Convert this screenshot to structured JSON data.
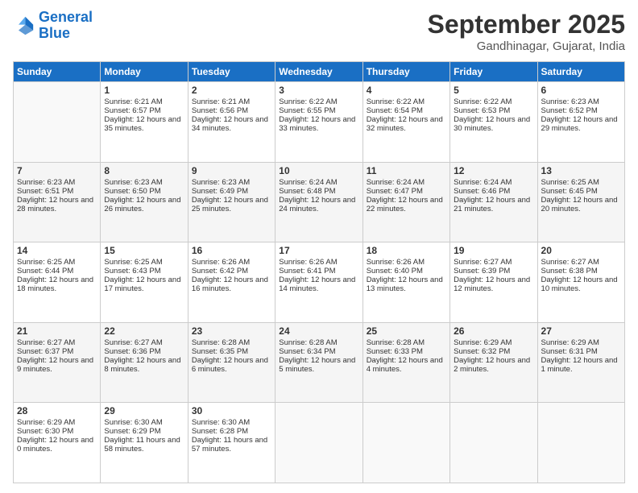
{
  "logo": {
    "line1": "General",
    "line2": "Blue"
  },
  "title": "September 2025",
  "location": "Gandhinagar, Gujarat, India",
  "days_header": [
    "Sunday",
    "Monday",
    "Tuesday",
    "Wednesday",
    "Thursday",
    "Friday",
    "Saturday"
  ],
  "weeks": [
    [
      {
        "day": "",
        "sunrise": "",
        "sunset": "",
        "daylight": ""
      },
      {
        "day": "1",
        "sunrise": "Sunrise: 6:21 AM",
        "sunset": "Sunset: 6:57 PM",
        "daylight": "Daylight: 12 hours and 35 minutes."
      },
      {
        "day": "2",
        "sunrise": "Sunrise: 6:21 AM",
        "sunset": "Sunset: 6:56 PM",
        "daylight": "Daylight: 12 hours and 34 minutes."
      },
      {
        "day": "3",
        "sunrise": "Sunrise: 6:22 AM",
        "sunset": "Sunset: 6:55 PM",
        "daylight": "Daylight: 12 hours and 33 minutes."
      },
      {
        "day": "4",
        "sunrise": "Sunrise: 6:22 AM",
        "sunset": "Sunset: 6:54 PM",
        "daylight": "Daylight: 12 hours and 32 minutes."
      },
      {
        "day": "5",
        "sunrise": "Sunrise: 6:22 AM",
        "sunset": "Sunset: 6:53 PM",
        "daylight": "Daylight: 12 hours and 30 minutes."
      },
      {
        "day": "6",
        "sunrise": "Sunrise: 6:23 AM",
        "sunset": "Sunset: 6:52 PM",
        "daylight": "Daylight: 12 hours and 29 minutes."
      }
    ],
    [
      {
        "day": "7",
        "sunrise": "Sunrise: 6:23 AM",
        "sunset": "Sunset: 6:51 PM",
        "daylight": "Daylight: 12 hours and 28 minutes."
      },
      {
        "day": "8",
        "sunrise": "Sunrise: 6:23 AM",
        "sunset": "Sunset: 6:50 PM",
        "daylight": "Daylight: 12 hours and 26 minutes."
      },
      {
        "day": "9",
        "sunrise": "Sunrise: 6:23 AM",
        "sunset": "Sunset: 6:49 PM",
        "daylight": "Daylight: 12 hours and 25 minutes."
      },
      {
        "day": "10",
        "sunrise": "Sunrise: 6:24 AM",
        "sunset": "Sunset: 6:48 PM",
        "daylight": "Daylight: 12 hours and 24 minutes."
      },
      {
        "day": "11",
        "sunrise": "Sunrise: 6:24 AM",
        "sunset": "Sunset: 6:47 PM",
        "daylight": "Daylight: 12 hours and 22 minutes."
      },
      {
        "day": "12",
        "sunrise": "Sunrise: 6:24 AM",
        "sunset": "Sunset: 6:46 PM",
        "daylight": "Daylight: 12 hours and 21 minutes."
      },
      {
        "day": "13",
        "sunrise": "Sunrise: 6:25 AM",
        "sunset": "Sunset: 6:45 PM",
        "daylight": "Daylight: 12 hours and 20 minutes."
      }
    ],
    [
      {
        "day": "14",
        "sunrise": "Sunrise: 6:25 AM",
        "sunset": "Sunset: 6:44 PM",
        "daylight": "Daylight: 12 hours and 18 minutes."
      },
      {
        "day": "15",
        "sunrise": "Sunrise: 6:25 AM",
        "sunset": "Sunset: 6:43 PM",
        "daylight": "Daylight: 12 hours and 17 minutes."
      },
      {
        "day": "16",
        "sunrise": "Sunrise: 6:26 AM",
        "sunset": "Sunset: 6:42 PM",
        "daylight": "Daylight: 12 hours and 16 minutes."
      },
      {
        "day": "17",
        "sunrise": "Sunrise: 6:26 AM",
        "sunset": "Sunset: 6:41 PM",
        "daylight": "Daylight: 12 hours and 14 minutes."
      },
      {
        "day": "18",
        "sunrise": "Sunrise: 6:26 AM",
        "sunset": "Sunset: 6:40 PM",
        "daylight": "Daylight: 12 hours and 13 minutes."
      },
      {
        "day": "19",
        "sunrise": "Sunrise: 6:27 AM",
        "sunset": "Sunset: 6:39 PM",
        "daylight": "Daylight: 12 hours and 12 minutes."
      },
      {
        "day": "20",
        "sunrise": "Sunrise: 6:27 AM",
        "sunset": "Sunset: 6:38 PM",
        "daylight": "Daylight: 12 hours and 10 minutes."
      }
    ],
    [
      {
        "day": "21",
        "sunrise": "Sunrise: 6:27 AM",
        "sunset": "Sunset: 6:37 PM",
        "daylight": "Daylight: 12 hours and 9 minutes."
      },
      {
        "day": "22",
        "sunrise": "Sunrise: 6:27 AM",
        "sunset": "Sunset: 6:36 PM",
        "daylight": "Daylight: 12 hours and 8 minutes."
      },
      {
        "day": "23",
        "sunrise": "Sunrise: 6:28 AM",
        "sunset": "Sunset: 6:35 PM",
        "daylight": "Daylight: 12 hours and 6 minutes."
      },
      {
        "day": "24",
        "sunrise": "Sunrise: 6:28 AM",
        "sunset": "Sunset: 6:34 PM",
        "daylight": "Daylight: 12 hours and 5 minutes."
      },
      {
        "day": "25",
        "sunrise": "Sunrise: 6:28 AM",
        "sunset": "Sunset: 6:33 PM",
        "daylight": "Daylight: 12 hours and 4 minutes."
      },
      {
        "day": "26",
        "sunrise": "Sunrise: 6:29 AM",
        "sunset": "Sunset: 6:32 PM",
        "daylight": "Daylight: 12 hours and 2 minutes."
      },
      {
        "day": "27",
        "sunrise": "Sunrise: 6:29 AM",
        "sunset": "Sunset: 6:31 PM",
        "daylight": "Daylight: 12 hours and 1 minute."
      }
    ],
    [
      {
        "day": "28",
        "sunrise": "Sunrise: 6:29 AM",
        "sunset": "Sunset: 6:30 PM",
        "daylight": "Daylight: 12 hours and 0 minutes."
      },
      {
        "day": "29",
        "sunrise": "Sunrise: 6:30 AM",
        "sunset": "Sunset: 6:29 PM",
        "daylight": "Daylight: 11 hours and 58 minutes."
      },
      {
        "day": "30",
        "sunrise": "Sunrise: 6:30 AM",
        "sunset": "Sunset: 6:28 PM",
        "daylight": "Daylight: 11 hours and 57 minutes."
      },
      {
        "day": "",
        "sunrise": "",
        "sunset": "",
        "daylight": ""
      },
      {
        "day": "",
        "sunrise": "",
        "sunset": "",
        "daylight": ""
      },
      {
        "day": "",
        "sunrise": "",
        "sunset": "",
        "daylight": ""
      },
      {
        "day": "",
        "sunrise": "",
        "sunset": "",
        "daylight": ""
      }
    ]
  ]
}
